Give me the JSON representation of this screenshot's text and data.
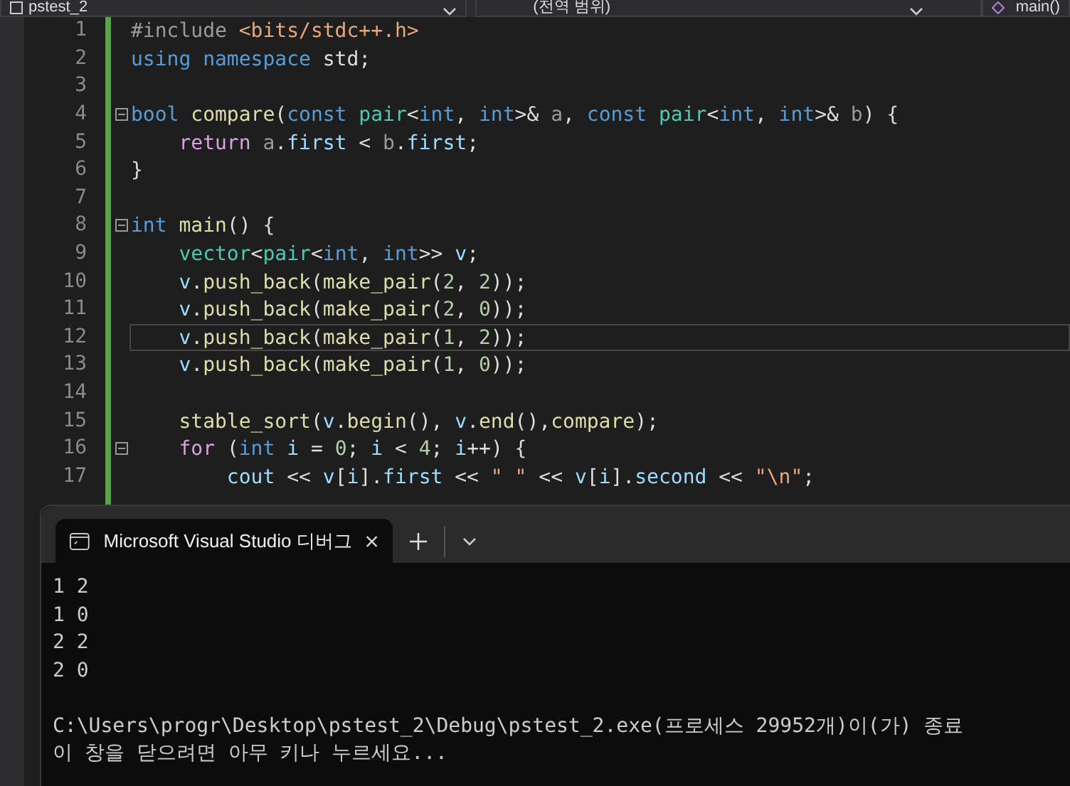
{
  "nav_bar": {
    "project": "pstest_2",
    "scope": "(전역 범위)",
    "member": "main()"
  },
  "editor": {
    "lines": [
      {
        "number": "1",
        "fold": false,
        "current": false,
        "tokens": [
          {
            "kind": "pre",
            "text": "#include"
          },
          {
            "kind": "str",
            "text": " <bits/stdc++.h>"
          }
        ]
      },
      {
        "number": "2",
        "fold": false,
        "current": false,
        "tokens": [
          {
            "kind": "kw",
            "text": "using namespace"
          },
          {
            "kind": "plain",
            "text": " std;"
          }
        ]
      },
      {
        "number": "3",
        "fold": false,
        "current": false
      },
      {
        "number": "4",
        "fold": true,
        "current": false,
        "tokens": [
          {
            "kind": "kw",
            "text": "bool"
          },
          {
            "kind": "fn",
            "text": " compare"
          },
          {
            "kind": "plain",
            "text": "("
          },
          {
            "kind": "kw",
            "text": "const"
          },
          {
            "kind": "type",
            "text": " pair"
          },
          {
            "kind": "plain",
            "text": "<"
          },
          {
            "kind": "kw",
            "text": "int"
          },
          {
            "kind": "plain",
            "text": ", "
          },
          {
            "kind": "kw",
            "text": "int"
          },
          {
            "kind": "plain",
            "text": ">& "
          },
          {
            "kind": "param",
            "text": "a"
          },
          {
            "kind": "plain",
            "text": ", "
          },
          {
            "kind": "kw",
            "text": "const"
          },
          {
            "kind": "type",
            "text": " pair"
          },
          {
            "kind": "plain",
            "text": "<"
          },
          {
            "kind": "kw",
            "text": "int"
          },
          {
            "kind": "plain",
            "text": ", "
          },
          {
            "kind": "kw",
            "text": "int"
          },
          {
            "kind": "plain",
            "text": ">& "
          },
          {
            "kind": "param",
            "text": "b"
          },
          {
            "kind": "plain",
            "text": ") {"
          }
        ]
      },
      {
        "number": "5",
        "fold": false,
        "current": false,
        "tokens": [
          {
            "kind": "ctrl",
            "text": "    return"
          },
          {
            "kind": "param",
            "text": " a"
          },
          {
            "kind": "plain",
            "text": "."
          },
          {
            "kind": "var",
            "text": "first"
          },
          {
            "kind": "plain",
            "text": " < "
          },
          {
            "kind": "param",
            "text": "b"
          },
          {
            "kind": "plain",
            "text": "."
          },
          {
            "kind": "var",
            "text": "first"
          },
          {
            "kind": "plain",
            "text": ";"
          }
        ]
      },
      {
        "number": "6",
        "fold": false,
        "current": false,
        "tokens": [
          {
            "kind": "plain",
            "text": "}"
          }
        ]
      },
      {
        "number": "7",
        "fold": false,
        "current": false
      },
      {
        "number": "8",
        "fold": true,
        "current": false,
        "tokens": [
          {
            "kind": "kw",
            "text": "int"
          },
          {
            "kind": "fn",
            "text": " main"
          },
          {
            "kind": "plain",
            "text": "() {"
          }
        ]
      },
      {
        "number": "9",
        "fold": false,
        "current": false,
        "tokens": [
          {
            "kind": "type",
            "text": "    vector"
          },
          {
            "kind": "plain",
            "text": "<"
          },
          {
            "kind": "type",
            "text": "pair"
          },
          {
            "kind": "plain",
            "text": "<"
          },
          {
            "kind": "kw",
            "text": "int"
          },
          {
            "kind": "plain",
            "text": ", "
          },
          {
            "kind": "kw",
            "text": "int"
          },
          {
            "kind": "plain",
            "text": ">> "
          },
          {
            "kind": "var",
            "text": "v"
          },
          {
            "kind": "plain",
            "text": ";"
          }
        ]
      },
      {
        "number": "10",
        "fold": false,
        "current": false,
        "tokens": [
          {
            "kind": "var",
            "text": "    v"
          },
          {
            "kind": "plain",
            "text": "."
          },
          {
            "kind": "fn",
            "text": "push_back"
          },
          {
            "kind": "plain",
            "text": "("
          },
          {
            "kind": "fn",
            "text": "make_pair"
          },
          {
            "kind": "plain",
            "text": "("
          },
          {
            "kind": "num",
            "text": "2"
          },
          {
            "kind": "plain",
            "text": ", "
          },
          {
            "kind": "num",
            "text": "2"
          },
          {
            "kind": "plain",
            "text": "));"
          }
        ]
      },
      {
        "number": "11",
        "fold": false,
        "current": false,
        "tokens": [
          {
            "kind": "var",
            "text": "    v"
          },
          {
            "kind": "plain",
            "text": "."
          },
          {
            "kind": "fn",
            "text": "push_back"
          },
          {
            "kind": "plain",
            "text": "("
          },
          {
            "kind": "fn",
            "text": "make_pair"
          },
          {
            "kind": "plain",
            "text": "("
          },
          {
            "kind": "num",
            "text": "2"
          },
          {
            "kind": "plain",
            "text": ", "
          },
          {
            "kind": "num",
            "text": "0"
          },
          {
            "kind": "plain",
            "text": "));"
          }
        ]
      },
      {
        "number": "12",
        "fold": false,
        "current": true,
        "tokens": [
          {
            "kind": "var",
            "text": "    v"
          },
          {
            "kind": "plain",
            "text": "."
          },
          {
            "kind": "fn",
            "text": "push_back"
          },
          {
            "kind": "plain",
            "text": "("
          },
          {
            "kind": "fn",
            "text": "make_pair"
          },
          {
            "kind": "plain",
            "text": "("
          },
          {
            "kind": "num",
            "text": "1"
          },
          {
            "kind": "plain",
            "text": ", "
          },
          {
            "kind": "num",
            "text": "2"
          },
          {
            "kind": "plain",
            "text": "));"
          }
        ]
      },
      {
        "number": "13",
        "fold": false,
        "current": false,
        "tokens": [
          {
            "kind": "var",
            "text": "    v"
          },
          {
            "kind": "plain",
            "text": "."
          },
          {
            "kind": "fn",
            "text": "push_back"
          },
          {
            "kind": "plain",
            "text": "("
          },
          {
            "kind": "fn",
            "text": "make_pair"
          },
          {
            "kind": "plain",
            "text": "("
          },
          {
            "kind": "num",
            "text": "1"
          },
          {
            "kind": "plain",
            "text": ", "
          },
          {
            "kind": "num",
            "text": "0"
          },
          {
            "kind": "plain",
            "text": "));"
          }
        ]
      },
      {
        "number": "14",
        "fold": false,
        "current": false
      },
      {
        "number": "15",
        "fold": false,
        "current": false,
        "tokens": [
          {
            "kind": "fn",
            "text": "    stable_sort"
          },
          {
            "kind": "plain",
            "text": "("
          },
          {
            "kind": "var",
            "text": "v"
          },
          {
            "kind": "plain",
            "text": "."
          },
          {
            "kind": "fn",
            "text": "begin"
          },
          {
            "kind": "plain",
            "text": "(), "
          },
          {
            "kind": "var",
            "text": "v"
          },
          {
            "kind": "plain",
            "text": "."
          },
          {
            "kind": "fn",
            "text": "end"
          },
          {
            "kind": "plain",
            "text": "(),"
          },
          {
            "kind": "fn",
            "text": "compare"
          },
          {
            "kind": "plain",
            "text": ");"
          }
        ]
      },
      {
        "number": "16",
        "fold": true,
        "current": false,
        "tokens": [
          {
            "kind": "ctrl",
            "text": "    for"
          },
          {
            "kind": "plain",
            "text": " ("
          },
          {
            "kind": "kw",
            "text": "int"
          },
          {
            "kind": "var",
            "text": " i"
          },
          {
            "kind": "plain",
            "text": " = "
          },
          {
            "kind": "num",
            "text": "0"
          },
          {
            "kind": "plain",
            "text": "; "
          },
          {
            "kind": "var",
            "text": "i"
          },
          {
            "kind": "plain",
            "text": " < "
          },
          {
            "kind": "num",
            "text": "4"
          },
          {
            "kind": "plain",
            "text": "; "
          },
          {
            "kind": "var",
            "text": "i"
          },
          {
            "kind": "plain",
            "text": "++) {"
          }
        ]
      },
      {
        "number": "17",
        "fold": false,
        "current": false,
        "tokens": [
          {
            "kind": "var",
            "text": "        cout"
          },
          {
            "kind": "plain",
            "text": " << "
          },
          {
            "kind": "var",
            "text": "v"
          },
          {
            "kind": "plain",
            "text": "["
          },
          {
            "kind": "var",
            "text": "i"
          },
          {
            "kind": "plain",
            "text": "]."
          },
          {
            "kind": "var",
            "text": "first"
          },
          {
            "kind": "plain",
            "text": " << "
          },
          {
            "kind": "str",
            "text": "\" \""
          },
          {
            "kind": "plain",
            "text": " << "
          },
          {
            "kind": "var",
            "text": "v"
          },
          {
            "kind": "plain",
            "text": "["
          },
          {
            "kind": "var",
            "text": "i"
          },
          {
            "kind": "plain",
            "text": "]."
          },
          {
            "kind": "var",
            "text": "second"
          },
          {
            "kind": "plain",
            "text": " << "
          },
          {
            "kind": "str",
            "text": "\"\\n\""
          },
          {
            "kind": "plain",
            "text": ";"
          }
        ]
      }
    ]
  },
  "terminal": {
    "tab": {
      "title": "Microsoft Visual Studio 디버그",
      "selected": true
    },
    "output": [
      "1 2",
      "1 0",
      "2 2",
      "2 0"
    ],
    "exit_message": [
      "C:\\Users\\progr\\Desktop\\pstest_2\\Debug\\pstest_2.exe(프로세스 29952개)이(가) 종료",
      "이 창을 닫으려면 아무 키나 누르세요..."
    ]
  }
}
